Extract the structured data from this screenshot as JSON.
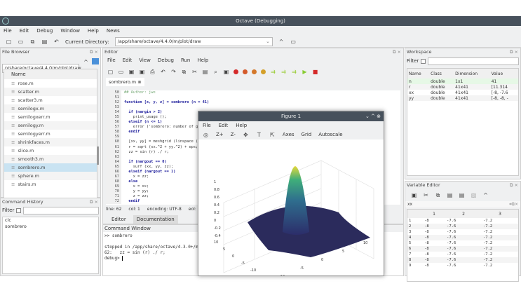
{
  "window": {
    "title": "Octave (Debugging)"
  },
  "menu": [
    "File",
    "Edit",
    "Debug",
    "Window",
    "Help",
    "News"
  ],
  "toolbar": {
    "cwd_label": "Current Directory:",
    "cwd_value": "/app/share/octave/4.4.0/m/plot/draw"
  },
  "file_browser": {
    "title": "File Browser",
    "path": "p/share/octave/4.4.0/m/plot/draw",
    "column": "Name",
    "files": [
      "rose.m",
      "scatter.m",
      "scatter3.m",
      "semilogx.m",
      "semilogxerr.m",
      "semilogy.m",
      "semilogyerr.m",
      "shrinkfaces.m",
      "slice.m",
      "smooth3.m",
      "sombrero.m",
      "sphere.m",
      "stairs.m"
    ],
    "selected": "sombrero.m"
  },
  "history": {
    "title": "Command History",
    "filter_label": "Filter",
    "items": [
      "clc",
      "sombrero"
    ]
  },
  "editor": {
    "title": "Editor",
    "menu": [
      "File",
      "Edit",
      "View",
      "Debug",
      "Run",
      "Help"
    ],
    "tab": "sombrero.m",
    "lines": [
      {
        "n": "50",
        "t": "## Author: jwe"
      },
      {
        "n": "51",
        "t": ""
      },
      {
        "n": "52",
        "t": "function [x, y, z] = sombrero (n = 41)"
      },
      {
        "n": "53",
        "t": ""
      },
      {
        "n": "54",
        "t": "  if (nargin > 2)"
      },
      {
        "n": "55",
        "t": "    print_usage ();"
      },
      {
        "n": "56",
        "t": "  elseif (n <= 1)"
      },
      {
        "n": "57",
        "t": "    error ('sombrero: number of gri"
      },
      {
        "n": "58",
        "t": "  endif"
      },
      {
        "n": "59",
        "t": ""
      },
      {
        "n": "60",
        "t": "  [xx, yy] = meshgrid (linspace (-8"
      },
      {
        "n": "61",
        "t": "  r = sqrt (xx.^2 + yy.^2) + eps;"
      },
      {
        "n": "62",
        "t": "  zz = sin (r) ./ r;"
      },
      {
        "n": "63",
        "t": ""
      },
      {
        "n": "64",
        "t": "  if (nargout == 0)"
      },
      {
        "n": "65",
        "t": "    surf (xx, yy, zz);"
      },
      {
        "n": "66",
        "t": "  elseif (nargout == 1)"
      },
      {
        "n": "67",
        "t": "    x = zz;"
      },
      {
        "n": "68",
        "t": "  else"
      },
      {
        "n": "69",
        "t": "    x = xx;"
      },
      {
        "n": "70",
        "t": "    y = yy;"
      },
      {
        "n": "71",
        "t": "    z = zz;"
      },
      {
        "n": "72",
        "t": "  endif"
      }
    ],
    "status": {
      "line": "line: 62",
      "col": "col: 1",
      "encoding": "encoding: UTF-8",
      "eol": "eol:"
    },
    "bottom_tabs": [
      "Editor",
      "Documentation"
    ]
  },
  "command_window": {
    "title": "Command Window",
    "lines": [
      ">> sombrero",
      "",
      "stopped in /app/share/octave/4.3.0+/m",
      "62:   zz = sin (r) ./ r;",
      "debug> "
    ]
  },
  "figure": {
    "title": "Figure 1",
    "menu": [
      "File",
      "Edit",
      "Help"
    ],
    "tools": [
      "Z+",
      "Z-",
      "Axes",
      "Grid",
      "Autoscale"
    ],
    "z_ticks": [
      "1",
      "0.8",
      "0.6",
      "0.4",
      "0.2",
      "0",
      "-0.2",
      "-0.4"
    ],
    "x_ticks": [
      "10",
      "5",
      "0",
      "-5",
      "-10"
    ],
    "y_ticks": [
      "-10",
      "-5",
      "0",
      "5",
      "10"
    ]
  },
  "workspace": {
    "title": "Workspace",
    "filter_label": "Filter",
    "columns": [
      "Name",
      "Class",
      "Dimension",
      "Value"
    ],
    "rows": [
      [
        "n",
        "double",
        "1x1",
        "41"
      ],
      [
        "r",
        "double",
        "41x41",
        "[11.314"
      ],
      [
        "xx",
        "double",
        "41x41",
        "[-8, -7.6"
      ],
      [
        "yy",
        "double",
        "41x41",
        "[-8, -8, -"
      ]
    ]
  },
  "variable_editor": {
    "title": "Variable Editor",
    "var": "xx",
    "columns": [
      "1",
      "2",
      "3"
    ],
    "rows": [
      [
        "1",
        "-8",
        "-7.6",
        "-7.2"
      ],
      [
        "2",
        "-8",
        "-7.6",
        "-7.2"
      ],
      [
        "3",
        "-8",
        "-7.6",
        "-7.2"
      ],
      [
        "4",
        "-8",
        "-7.6",
        "-7.2"
      ],
      [
        "5",
        "-8",
        "-7.6",
        "-7.2"
      ],
      [
        "6",
        "-8",
        "-7.6",
        "-7.2"
      ],
      [
        "7",
        "-8",
        "-7.6",
        "-7.2"
      ],
      [
        "8",
        "-8",
        "-7.6",
        "-7.2"
      ],
      [
        "9",
        "-8",
        "-7.6",
        "-7.2"
      ]
    ]
  }
}
